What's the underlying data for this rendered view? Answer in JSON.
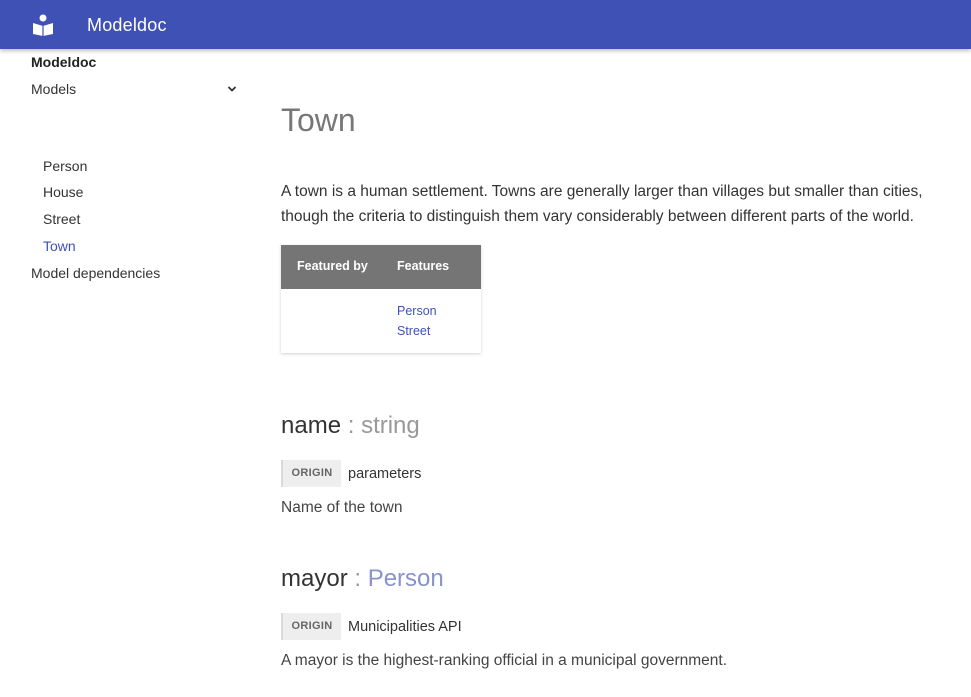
{
  "header": {
    "title": "Modeldoc",
    "logo_icon": "book-reader-icon",
    "color": "#3f51b5"
  },
  "sidebar": {
    "root": "Modeldoc",
    "models_label": "Models",
    "models_icon": "chevron-down-icon",
    "items": [
      {
        "label": "Person",
        "active": false
      },
      {
        "label": "House",
        "active": false
      },
      {
        "label": "Street",
        "active": false
      },
      {
        "label": "Town",
        "active": true
      }
    ],
    "dependencies_label": "Model dependencies"
  },
  "main": {
    "title": "Town",
    "description": "A town is a human settlement. Towns are generally larger than villages but smaller than cities, though the criteria to distinguish them vary considerably between different parts of the world.",
    "feature_table": {
      "headers": [
        "Featured by",
        "Features"
      ],
      "featured_by": [],
      "features": [
        "Person",
        "Street"
      ]
    },
    "properties": [
      {
        "name": "name",
        "separator": " : ",
        "type": "string",
        "origin_label": "ORIGIN",
        "origin": "parameters",
        "description": "Name of the town"
      },
      {
        "name": "mayor",
        "separator": " : ",
        "type": "Person",
        "origin_label": "ORIGIN",
        "origin": "Municipalities API",
        "description": "A mayor is the highest-ranking official in a municipal government."
      }
    ]
  }
}
